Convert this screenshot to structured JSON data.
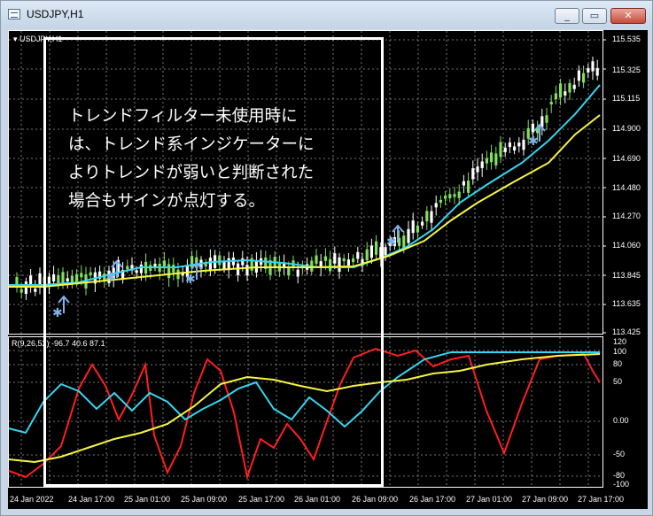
{
  "window": {
    "title": "USDJPY,H1",
    "buttons": {
      "minimize": "_",
      "maximize": "▭",
      "close": "✕"
    }
  },
  "chart": {
    "symbol_header": "USDJPY,H1",
    "indicator_label": "R(9,26,52) -96.7 40.6 87.1",
    "price_axis": [
      "115.535",
      "115.325",
      "115.115",
      "114.900",
      "114.690",
      "114.480",
      "114.270",
      "114.060",
      "113.845",
      "113.635",
      "113.425"
    ],
    "osc_axis": [
      "120",
      "100",
      "80",
      "50",
      "0.00",
      "-50",
      "-80",
      "-100"
    ],
    "time_axis": [
      "24 Jan 2022",
      "24 Jan 17:00",
      "25 Jan 01:00",
      "25 Jan 09:00",
      "25 Jan 17:00",
      "26 Jan 01:00",
      "26 Jan 09:00",
      "26 Jan 17:00",
      "27 Jan 01:00",
      "27 Jan 09:00",
      "27 Jan 17:00"
    ],
    "annotation_lines": [
      "トレンドフィルター未使用時に",
      "は、トレンド系インジケーターに",
      "よりトレンドが弱いと判断された",
      "場合もサインが点灯する。"
    ],
    "colors": {
      "background": "#000000",
      "candle_up": "#7fe05a",
      "candle_down": "#ffffff",
      "ma_fast": "#33d6f0",
      "ma_slow": "#f5f542",
      "osc_red": "#ff1f1f",
      "signal_arrow": "#7fb2e8"
    },
    "signal_icons": [
      "star-arrow-up",
      "star-arrow-up",
      "star-arrow-up",
      "star-arrow-up",
      "star-arrow-up"
    ]
  }
}
